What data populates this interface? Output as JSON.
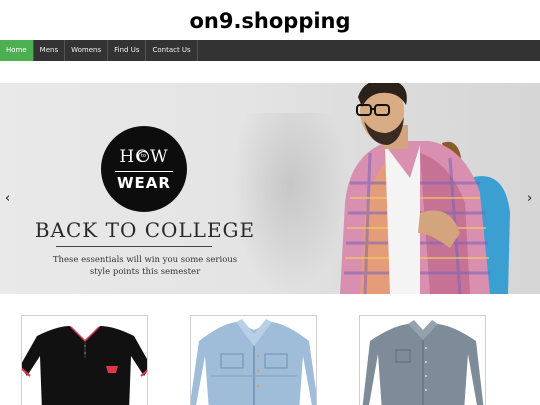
{
  "site": {
    "title": "on9.shopping"
  },
  "nav": {
    "items": [
      {
        "label": "Home",
        "active": true
      },
      {
        "label": "Mens",
        "active": false
      },
      {
        "label": "Womens",
        "active": false
      },
      {
        "label": "Find Us",
        "active": false
      },
      {
        "label": "Contact Us",
        "active": false
      }
    ]
  },
  "slider": {
    "badge": {
      "line1": "HOW",
      "small": "to",
      "line2": "WEAR"
    },
    "headline": "BACK TO COLLEGE",
    "subcopy_line1": "These essentials will win you some serious",
    "subcopy_line2": "style points this semester",
    "prev_glyph": "‹",
    "next_glyph": "›"
  },
  "products": [
    {
      "kind": "polo-shirt",
      "color": "#111111"
    },
    {
      "kind": "denim-jacket",
      "color": "#9fbcd9"
    },
    {
      "kind": "button-down-shirt",
      "color": "#7e8c99"
    }
  ],
  "colors": {
    "nav_bg": "#333333",
    "nav_active": "#4caf50"
  }
}
